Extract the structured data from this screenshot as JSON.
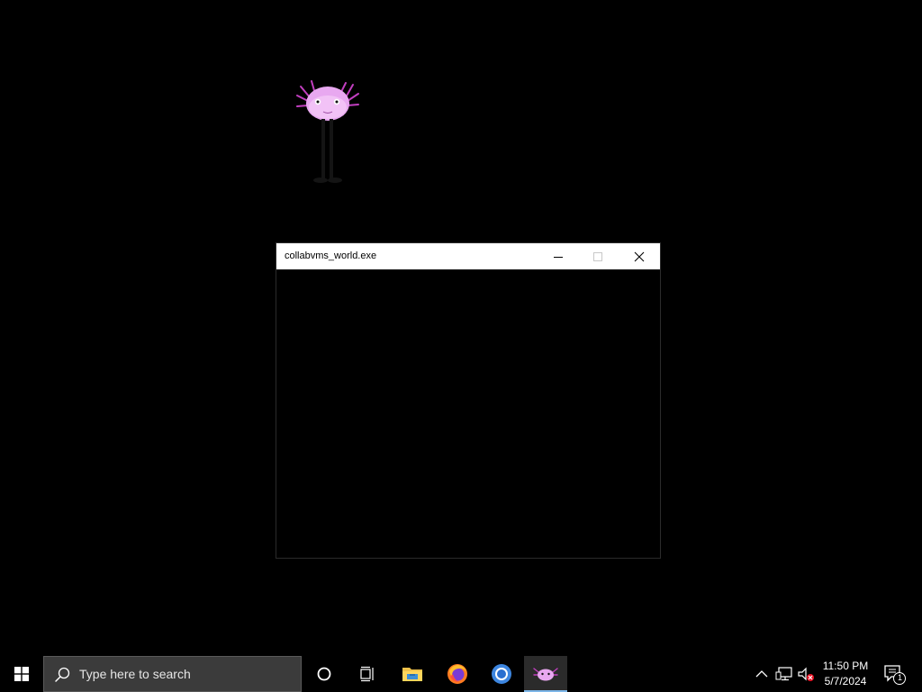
{
  "window": {
    "title": "collabvms_world.exe"
  },
  "taskbar": {
    "search_placeholder": "Type here to search",
    "pinned": [
      {
        "name": "cortana-icon"
      },
      {
        "name": "task-view-icon"
      },
      {
        "name": "file-explorer-icon"
      },
      {
        "name": "firefox-icon"
      },
      {
        "name": "chrome-icon"
      },
      {
        "name": "collabvms-world-app-icon",
        "active": true
      }
    ],
    "clock": {
      "time": "11:50 PM",
      "date": "5/7/2024"
    },
    "notifications": {
      "count": "1"
    }
  },
  "colors": {
    "desktop": "#000000",
    "taskbar": "#000000",
    "search_box": "#3b3b3b",
    "titlebar": "#ffffff",
    "mascot_body": "#e8a8f0",
    "running_indicator": "#7cb6e8"
  }
}
